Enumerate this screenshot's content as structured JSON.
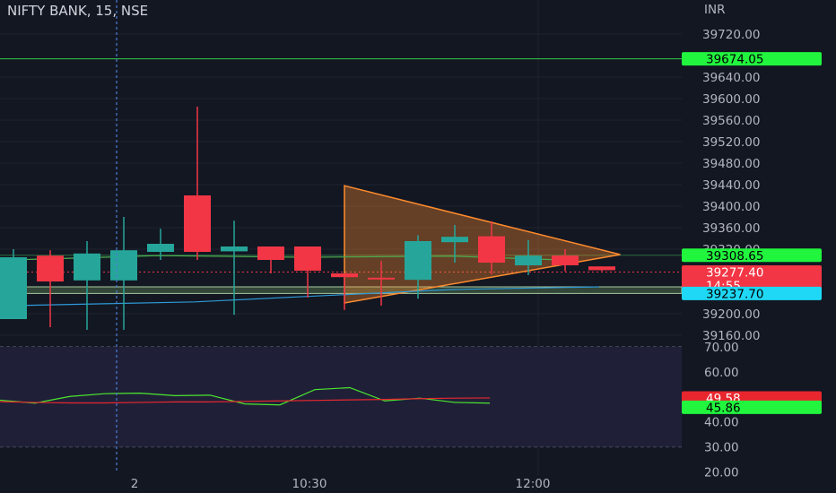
{
  "header": {
    "title": "NIFTY BANK, 15, NSE",
    "currency": "INR"
  },
  "colors": {
    "background": "#131722",
    "up": "#26a69a",
    "down": "#f23645",
    "rsi_line": "#4be62e",
    "rsi_ma": "#e8262e",
    "triangle": "#ff8c2e",
    "blue_line": "#2e9ad8",
    "green_hline": "#35c94a",
    "cyan_tag": "#1ed8f5",
    "last_tag": "#f23645",
    "green_tag": "#21f53e",
    "crosshair": "#4a7dd6",
    "grid": "#1f2330",
    "axis_text": "#b2b5be"
  },
  "chart_data": [
    {
      "type": "candlestick",
      "title": "NIFTY BANK, 15, NSE",
      "ylabel": "INR",
      "ylim": [
        39160,
        39740
      ],
      "x_ticks": [
        "2",
        "10:30",
        "12:00"
      ],
      "y_ticks": [
        "39720.00",
        "39640.00",
        "39600.00",
        "39560.00",
        "39520.00",
        "39480.00",
        "39440.00",
        "39400.00",
        "39360.00",
        "39320.00",
        "39200.00",
        "39160.00"
      ],
      "candles": [
        {
          "o": 39190,
          "h": 39320,
          "l": 39190,
          "c": 39305
        },
        {
          "o": 39308,
          "h": 39318,
          "l": 39175,
          "c": 39260
        },
        {
          "o": 39262,
          "h": 39335,
          "l": 39170,
          "c": 39312
        },
        {
          "o": 39262,
          "h": 39380,
          "l": 39170,
          "c": 39318
        },
        {
          "o": 39315,
          "h": 39358,
          "l": 39300,
          "c": 39330
        },
        {
          "o": 39420,
          "h": 39585,
          "l": 39300,
          "c": 39315
        },
        {
          "o": 39316,
          "h": 39373,
          "l": 39198,
          "c": 39325
        },
        {
          "o": 39325,
          "h": 39305,
          "l": 39275,
          "c": 39300
        },
        {
          "o": 39325,
          "h": 39310,
          "l": 39230,
          "c": 39280
        },
        {
          "o": 39275,
          "h": 39267,
          "l": 39207,
          "c": 39268
        },
        {
          "o": 39267,
          "h": 39298,
          "l": 39215,
          "c": 39265
        },
        {
          "o": 39263,
          "h": 39346,
          "l": 39228,
          "c": 39335
        },
        {
          "o": 39333,
          "h": 39365,
          "l": 39295,
          "c": 39343
        },
        {
          "o": 39344,
          "h": 39372,
          "l": 39273,
          "c": 39295
        },
        {
          "o": 39290,
          "h": 39337,
          "l": 39272,
          "c": 39308
        },
        {
          "o": 39308,
          "h": 39320,
          "l": 39279,
          "c": 39290
        },
        {
          "o": 39288,
          "h": 39288,
          "l": 39279,
          "c": 39281
        }
      ],
      "price_tags": [
        {
          "label": "39674.05",
          "value": 39674.05,
          "kind": "green"
        },
        {
          "label": "39308.65",
          "value": 39308.65,
          "kind": "green"
        },
        {
          "label": "39277.40",
          "sub": "14:55",
          "value": 39277.4,
          "kind": "last"
        },
        {
          "label": "39237.70",
          "value": 39237.7,
          "kind": "cyan"
        }
      ],
      "horizontal_levels": [
        39674.05,
        39308.65,
        39250,
        39237.7
      ],
      "drawings": {
        "triangle": [
          [
            9,
            39438
          ],
          [
            9,
            39220
          ],
          [
            16.5,
            39310
          ]
        ],
        "blue_curve": [
          [
            0,
            39215
          ],
          [
            5,
            39222
          ],
          [
            8,
            39232
          ],
          [
            12,
            39245
          ],
          [
            16,
            39250
          ]
        ],
        "green_ma": [
          [
            0,
            39300
          ],
          [
            4,
            39308
          ],
          [
            8,
            39305
          ],
          [
            12,
            39307
          ],
          [
            15,
            39300
          ]
        ]
      }
    },
    {
      "type": "line",
      "title": "RSI",
      "ylim": [
        20,
        70
      ],
      "y_ticks": [
        "70.00",
        "60.00",
        "50.00",
        "40.00",
        "30.00",
        "20.00"
      ],
      "series": [
        {
          "values": [
            48.7,
            47.5,
            50.2,
            51.3,
            51.5,
            50.5,
            50.7,
            47.2,
            46.8,
            52.9,
            53.7,
            48.4,
            49.5,
            47.8,
            47.5
          ]
        },
        {
          "values": [
            48.1,
            47.8,
            47.6,
            47.6,
            47.8,
            48.0,
            48.0,
            48.2,
            48.4,
            48.6,
            48.8,
            49.0,
            49.3,
            49.5,
            49.6
          ]
        }
      ],
      "price_tags": [
        {
          "label": "49.58",
          "value": 49.58,
          "kind": "red"
        },
        {
          "label": "45.86",
          "value": 45.86,
          "kind": "green"
        }
      ]
    }
  ]
}
